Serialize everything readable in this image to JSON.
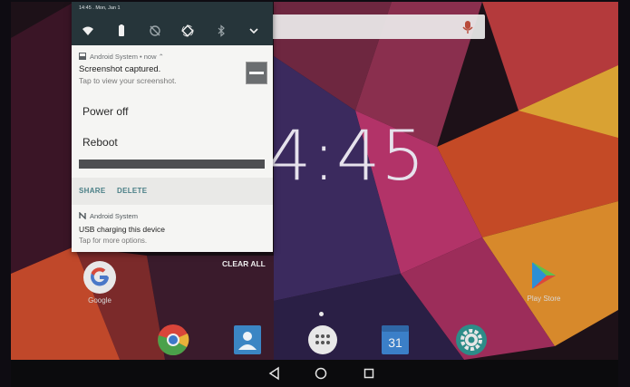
{
  "status_bar": {
    "time_date": "14:45 . Mon, Jan 1"
  },
  "quick_settings": {
    "icons": [
      "wifi-icon",
      "battery-icon",
      "do-not-disturb-icon",
      "auto-rotate-icon",
      "bluetooth-icon",
      "expand-chevron-icon"
    ]
  },
  "screenshot_notification": {
    "app_row": "Android System • now ⌃",
    "title": "Screenshot captured.",
    "text": "Tap to view your screenshot."
  },
  "power_menu": {
    "power_off": "Power off",
    "reboot": "Reboot"
  },
  "notification_actions": {
    "share": "SHARE",
    "delete": "DELETE"
  },
  "usb_notification": {
    "app": "Android System",
    "title": "USB charging this device",
    "text": "Tap for more options."
  },
  "clear_all": "CLEAR ALL",
  "clock": "4:45",
  "home": {
    "google_label": "Google",
    "play_store_label": "Play Store",
    "calendar_day": "31"
  },
  "colors": {
    "shade_background": "#f5f5f3",
    "quick_settings_background": "#26353a",
    "action_accent": "#4a7f86"
  }
}
